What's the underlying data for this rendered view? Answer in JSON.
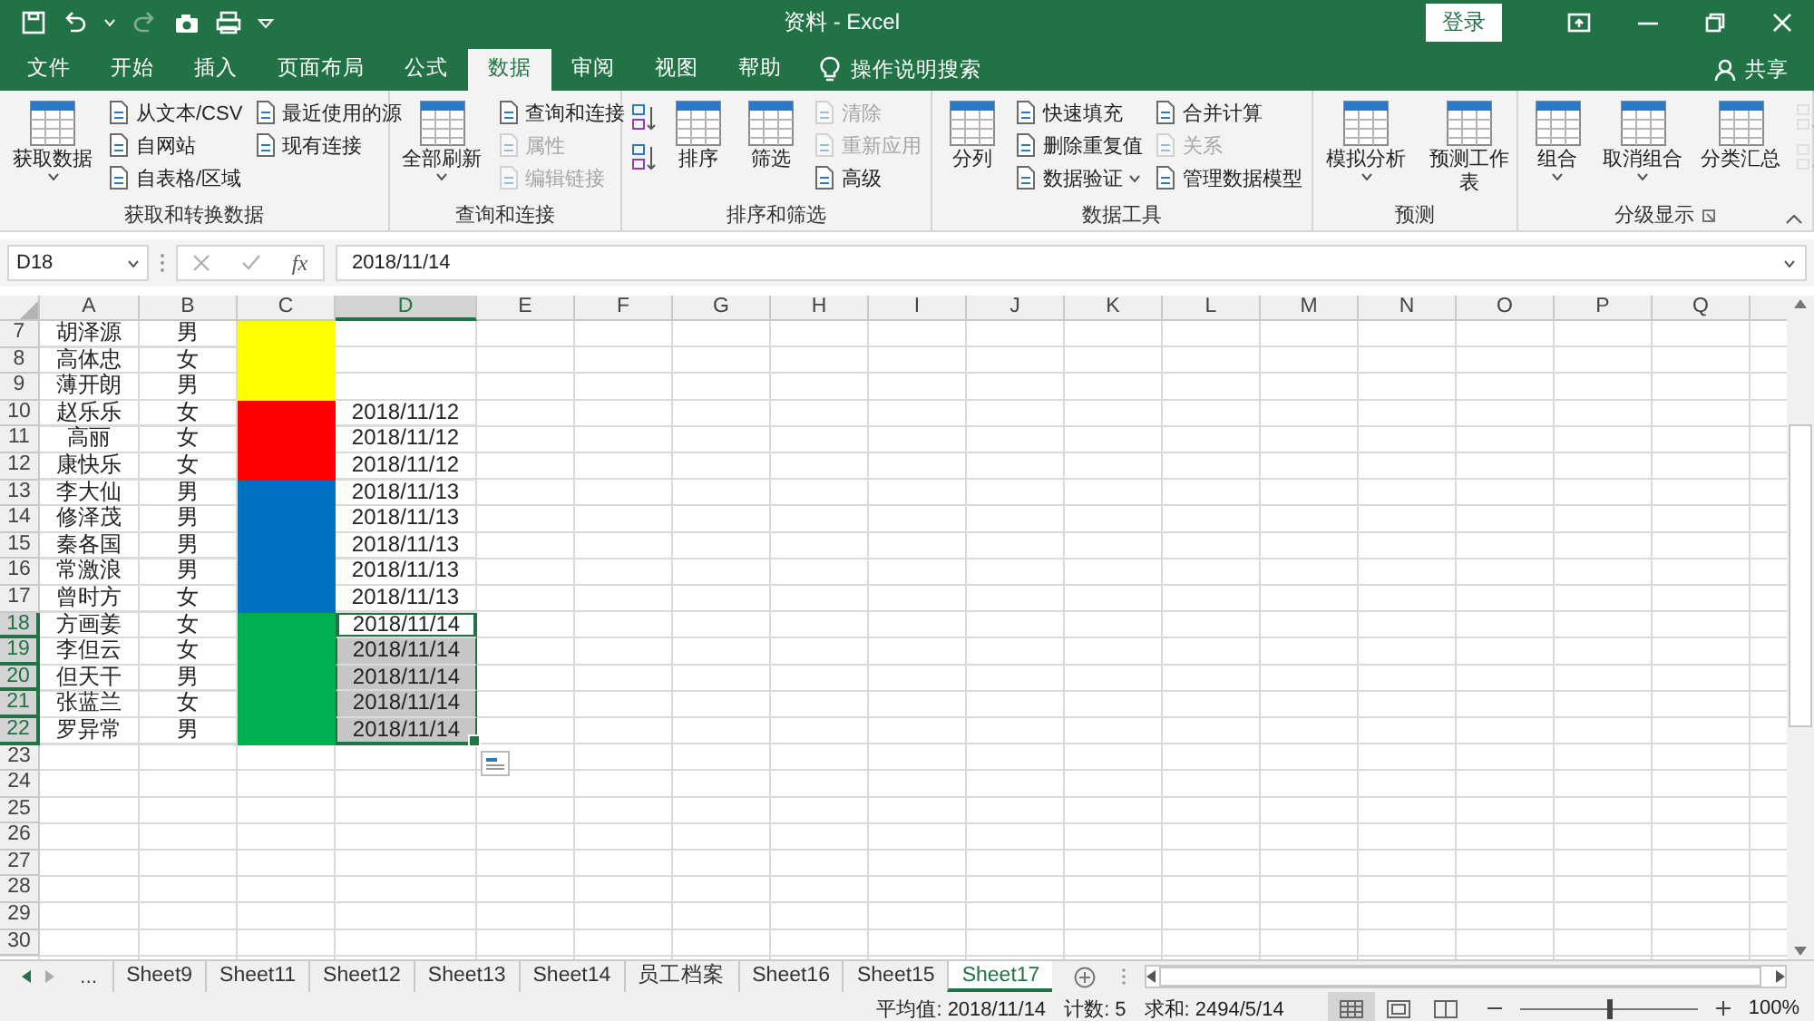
{
  "window": {
    "title": "资料 - Excel",
    "sign_in": "登录"
  },
  "menu_tabs": [
    {
      "label": "文件",
      "selected": false
    },
    {
      "label": "开始",
      "selected": false
    },
    {
      "label": "插入",
      "selected": false
    },
    {
      "label": "页面布局",
      "selected": false
    },
    {
      "label": "公式",
      "selected": false
    },
    {
      "label": "数据",
      "selected": true
    },
    {
      "label": "审阅",
      "selected": false
    },
    {
      "label": "视图",
      "selected": false
    },
    {
      "label": "帮助",
      "selected": false
    }
  ],
  "tell_me": "操作说明搜索",
  "share": "共享",
  "ribbon_groups": [
    {
      "label": "获取和转换数据",
      "items": [
        {
          "kind": "large",
          "label": "获取数据",
          "menu": true
        },
        {
          "kind": "small",
          "label": "从文本/CSV",
          "disabled": false
        },
        {
          "kind": "small",
          "label": "自网站",
          "disabled": false
        },
        {
          "kind": "small",
          "label": "自表格/区域",
          "disabled": false
        },
        {
          "kind": "small",
          "label": "最近使用的源",
          "disabled": false
        },
        {
          "kind": "small",
          "label": "现有连接",
          "disabled": false
        }
      ]
    },
    {
      "label": "查询和连接",
      "items": [
        {
          "kind": "large",
          "label": "全部刷新",
          "menu": true
        },
        {
          "kind": "small",
          "label": "查询和连接",
          "disabled": false
        },
        {
          "kind": "small",
          "label": "属性",
          "disabled": true
        },
        {
          "kind": "small",
          "label": "编辑链接",
          "disabled": true
        }
      ]
    },
    {
      "label": "排序和筛选",
      "items": [
        {
          "kind": "icons",
          "disabled": false
        },
        {
          "kind": "large",
          "label": "排序",
          "menu": false
        },
        {
          "kind": "large",
          "label": "筛选",
          "menu": false
        },
        {
          "kind": "small",
          "label": "清除",
          "disabled": true
        },
        {
          "kind": "small",
          "label": "重新应用",
          "disabled": true
        },
        {
          "kind": "small",
          "label": "高级",
          "disabled": false
        }
      ]
    },
    {
      "label": "数据工具",
      "items": [
        {
          "kind": "large",
          "label": "分列",
          "menu": false
        },
        {
          "kind": "small",
          "label": "快速填充",
          "disabled": false
        },
        {
          "kind": "small",
          "label": "删除重复值",
          "disabled": false
        },
        {
          "kind": "small",
          "label": "数据验证",
          "disabled": false,
          "menu": true
        },
        {
          "kind": "small",
          "label": "合并计算",
          "disabled": false
        },
        {
          "kind": "small",
          "label": "关系",
          "disabled": true
        },
        {
          "kind": "small",
          "label": "管理数据模型",
          "disabled": false
        }
      ]
    },
    {
      "label": "预测",
      "items": [
        {
          "kind": "large",
          "label": "模拟分析",
          "menu": true
        },
        {
          "kind": "large",
          "label": "预测工作表",
          "menu": false
        }
      ]
    },
    {
      "label": "分级显示",
      "items": [
        {
          "kind": "large",
          "label": "组合",
          "menu": true
        },
        {
          "kind": "large",
          "label": "取消组合",
          "menu": true
        },
        {
          "kind": "large",
          "label": "分类汇总",
          "menu": false
        },
        {
          "kind": "icons",
          "disabled": true
        }
      ]
    }
  ],
  "formula_bar": {
    "name_box": "D18",
    "fx": "fx",
    "value": "2018/11/14"
  },
  "columns": [
    {
      "label": "A",
      "selected": false
    },
    {
      "label": "B",
      "selected": false
    },
    {
      "label": "C",
      "selected": false
    },
    {
      "label": "D",
      "selected": true
    },
    {
      "label": "E",
      "selected": false
    },
    {
      "label": "F",
      "selected": false
    },
    {
      "label": "G",
      "selected": false
    },
    {
      "label": "H",
      "selected": false
    },
    {
      "label": "I",
      "selected": false
    },
    {
      "label": "J",
      "selected": false
    },
    {
      "label": "K",
      "selected": false
    },
    {
      "label": "L",
      "selected": false
    },
    {
      "label": "M",
      "selected": false
    },
    {
      "label": "N",
      "selected": false
    },
    {
      "label": "O",
      "selected": false
    },
    {
      "label": "P",
      "selected": false
    },
    {
      "label": "Q",
      "selected": false
    }
  ],
  "rows": [
    {
      "number": "7",
      "name": "胡泽源",
      "gender": "男",
      "color": "#ffff00",
      "selected": false,
      "active": false
    },
    {
      "number": "8",
      "name": "高体忠",
      "gender": "女",
      "color": "#ffff00",
      "selected": false,
      "active": false
    },
    {
      "number": "9",
      "name": "薄开朗",
      "gender": "男",
      "color": "#ffff00",
      "selected": false,
      "active": false
    },
    {
      "number": "10",
      "name": "赵乐乐",
      "gender": "女",
      "color": "#ff0000",
      "date": "2018/11/12",
      "selected": false,
      "active": false
    },
    {
      "number": "11",
      "name": "高丽",
      "gender": "女",
      "color": "#ff0000",
      "date": "2018/11/12",
      "selected": false,
      "active": false
    },
    {
      "number": "12",
      "name": "康快乐",
      "gender": "女",
      "color": "#ff0000",
      "date": "2018/11/12",
      "selected": false,
      "active": false
    },
    {
      "number": "13",
      "name": "李大仙",
      "gender": "男",
      "color": "#0070c0",
      "date": "2018/11/13",
      "selected": false,
      "active": false
    },
    {
      "number": "14",
      "name": "修泽茂",
      "gender": "男",
      "color": "#0070c0",
      "date": "2018/11/13",
      "selected": false,
      "active": false
    },
    {
      "number": "15",
      "name": "秦各国",
      "gender": "男",
      "color": "#0070c0",
      "date": "2018/11/13",
      "selected": false,
      "active": false
    },
    {
      "number": "16",
      "name": "常激浪",
      "gender": "男",
      "color": "#0070c0",
      "date": "2018/11/13",
      "selected": false,
      "active": false
    },
    {
      "number": "17",
      "name": "曾时方",
      "gender": "女",
      "color": "#0070c0",
      "date": "2018/11/13",
      "selected": false,
      "active": false
    },
    {
      "number": "18",
      "name": "方画姜",
      "gender": "女",
      "color": "#00b050",
      "date": "2018/11/14",
      "selected": true,
      "active": true
    },
    {
      "number": "19",
      "name": "李但云",
      "gender": "女",
      "color": "#00b050",
      "date": "2018/11/14",
      "selected": true,
      "active": false
    },
    {
      "number": "20",
      "name": "但天干",
      "gender": "男",
      "color": "#00b050",
      "date": "2018/11/14",
      "selected": true,
      "active": false
    },
    {
      "number": "21",
      "name": "张蓝兰",
      "gender": "女",
      "color": "#00b050",
      "date": "2018/11/14",
      "selected": true,
      "active": false
    },
    {
      "number": "22",
      "name": "罗异常",
      "gender": "男",
      "color": "#00b050",
      "date": "2018/11/14",
      "selected": true,
      "active": false
    },
    {
      "number": "23",
      "selected": false,
      "active": false
    },
    {
      "number": "24",
      "selected": false,
      "active": false
    },
    {
      "number": "25",
      "selected": false,
      "active": false
    },
    {
      "number": "26",
      "selected": false,
      "active": false
    },
    {
      "number": "27",
      "selected": false,
      "active": false
    },
    {
      "number": "28",
      "selected": false,
      "active": false
    },
    {
      "number": "29",
      "selected": false,
      "active": false
    },
    {
      "number": "30",
      "selected": false,
      "active": false
    }
  ],
  "sheet_tabs_more": "...",
  "sheet_tabs": [
    {
      "label": "Sheet9",
      "selected": false
    },
    {
      "label": "Sheet11",
      "selected": false
    },
    {
      "label": "Sheet12",
      "selected": false
    },
    {
      "label": "Sheet13",
      "selected": false
    },
    {
      "label": "Sheet14",
      "selected": false
    },
    {
      "label": "员工档案",
      "selected": false
    },
    {
      "label": "Sheet16",
      "selected": false
    },
    {
      "label": "Sheet15",
      "selected": false
    },
    {
      "label": "Sheet17",
      "selected": true
    }
  ],
  "status_bar": {
    "average": "平均值: 2018/11/14",
    "count": "计数: 5",
    "sum": "求和: 2494/5/14",
    "views": [
      {
        "selected": true
      },
      {
        "selected": false
      },
      {
        "selected": false
      }
    ],
    "zoom": {
      "level": 0.5,
      "reading": "100%"
    }
  }
}
